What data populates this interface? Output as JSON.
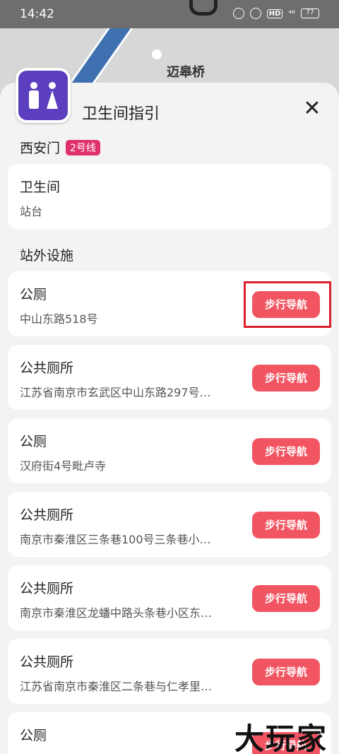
{
  "status_bar": {
    "time": "14:42",
    "hd_label": "HD",
    "signal_label": "⁴⁶",
    "battery": "77"
  },
  "map": {
    "station_label": "迈皋桥"
  },
  "sheet": {
    "title": "卫生间指引",
    "close_icon": "close-icon",
    "station": "西安门",
    "line_badge": "2号线",
    "accent_color": "#f25562"
  },
  "inside_card": {
    "title": "卫生间",
    "location": "站台"
  },
  "outside_section_title": "站外设施",
  "facilities": [
    {
      "name": "公厕",
      "address": "中山东路518号",
      "button": "步行导航"
    },
    {
      "name": "公共厕所",
      "address": "江苏省南京市玄武区中山东路297号…",
      "button": "步行导航"
    },
    {
      "name": "公厕",
      "address": "汉府街4号毗卢寺",
      "button": "步行导航"
    },
    {
      "name": "公共厕所",
      "address": "南京市秦淮区三条巷100号三条巷小…",
      "button": "步行导航"
    },
    {
      "name": "公共厕所",
      "address": "南京市秦淮区龙蟠中路头条巷小区东…",
      "button": "步行导航"
    },
    {
      "name": "公共厕所",
      "address": "江苏省南京市秦淮区二条巷与仁孝里…",
      "button": "步行导航"
    },
    {
      "name": "公厕",
      "address": "",
      "button": "步行导航"
    }
  ],
  "watermark": "大玩家"
}
